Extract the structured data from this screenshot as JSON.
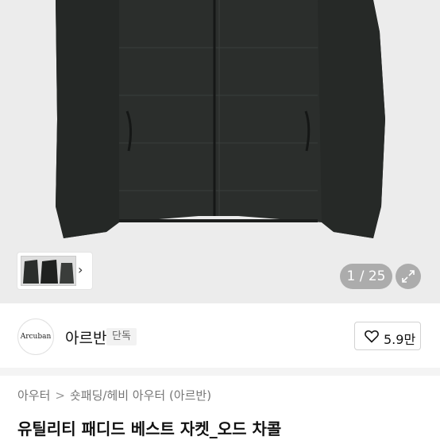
{
  "gallery": {
    "counter": "1 / 25",
    "next_arrow": "›"
  },
  "brand": {
    "logo_text": "Arcuban",
    "name": "아르반",
    "badge": "단독",
    "likes": "5.9만"
  },
  "breadcrumb": {
    "level1": "아우터",
    "separator": ">",
    "level2": "숏패딩/헤비 아우터 (아르반)"
  },
  "product": {
    "title": "유틸리티 패디드 베스트 자켓_오드 차콜"
  },
  "colors": {
    "jacket": "#2b2e2c",
    "hero_bg": "#ececec"
  }
}
